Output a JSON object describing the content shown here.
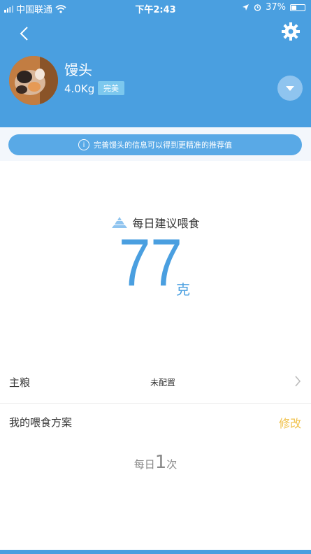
{
  "status_bar": {
    "carrier": "中国联通",
    "time": "下午2:43",
    "battery_percent": "37%"
  },
  "pet": {
    "name": "馒头",
    "weight": "4.0Kg",
    "badge": "完美"
  },
  "info_banner": {
    "text": "完善馒头的信息可以得到更精准的推荐值"
  },
  "recommendation": {
    "label": "每日建议喂食",
    "amount": "77",
    "unit": "克"
  },
  "main_food": {
    "label": "主粮",
    "value": "未配置"
  },
  "feeding_plan": {
    "title": "我的喂食方案",
    "edit_label": "修改",
    "freq_prefix": "每日",
    "freq_count": "1",
    "freq_suffix": "次"
  },
  "colors": {
    "primary": "#4a9fe0",
    "accent": "#f0c14b"
  },
  "icons": {
    "back": "chevron-left-icon",
    "settings": "gear-icon",
    "dropdown": "chevron-down-icon",
    "info": "info-icon",
    "food": "pyramid-icon",
    "row_arrow": "chevron-right-icon"
  }
}
